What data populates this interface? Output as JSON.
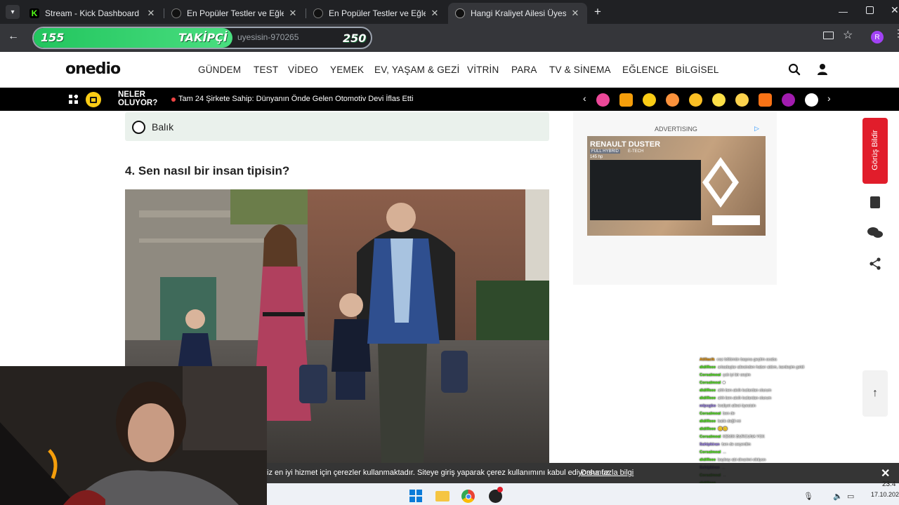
{
  "browser": {
    "tabs": [
      {
        "label": "Stream - Kick Dashboard",
        "icon": "kick-icon",
        "color": "#53fc18"
      },
      {
        "label": "En Popüler Testler ve Eğlenceli",
        "icon": "onedio-icon"
      },
      {
        "label": "En Popüler Testler ve Eğlenceli",
        "icon": "onedio-icon"
      },
      {
        "label": "Hangi Kraliyet Ailesi Üyesisin?",
        "icon": "onedio-icon"
      }
    ],
    "url_fragment": "uyesisin-970265",
    "profile_initial": "R"
  },
  "follow_overlay": {
    "count": "155",
    "label": "TAKİPÇİ",
    "goal": "250",
    "progress": 0.62
  },
  "site": {
    "logo": "onedio",
    "nav": [
      "GÜNDEM",
      "TEST",
      "VİDEO",
      "YEMEK",
      "EV, YAŞAM & GEZİ",
      "VİTRİN",
      "PARA",
      "TV & SİNEMA",
      "EĞLENCE",
      "BİLGİSEL"
    ],
    "ticker_heading": "NELER OLUYOR?",
    "ticker_text": "Tam 24 Şirkete Sahip: Dünyanın Önde Gelen Otomotiv Devi İflas Etti"
  },
  "quiz": {
    "option_label": "Balık",
    "question": "4. Sen nasıl bir insan tipisin?"
  },
  "ad": {
    "label": "ADVERTISING",
    "brand": "RENAULT DUSTER",
    "model": "FULL HYBRID",
    "variant": "E-TECH",
    "power": "145 hp"
  },
  "sidebar": {
    "feedback_label": "Görüş Bildir"
  },
  "cookie": {
    "text": "iz en iyi hizmet için çerezler kullanmaktadır. Siteye giriş yaparak çerez kullanımını kabul ediyorsunuz.",
    "link": "Daha fazla bilgi"
  },
  "chat": [
    {
      "user": "Atillacik",
      "color": "#f59e0b",
      "msg": "ıraz bölümün başına geçtim acaba"
    },
    {
      "user": "didiffeee",
      "color": "#53fc18",
      "msg": "arkadaşlar ailesinden haber aldım, kardeşim geldi"
    },
    {
      "user": "Corsalmeal",
      "color": "#53fc18",
      "msg": "çok iyi bir seçim"
    },
    {
      "user": "Corsalmeal",
      "color": "#53fc18",
      "msg": "■"
    },
    {
      "user": "didiffeee",
      "color": "#53fc18",
      "msg": "ahh ben akıllı kızlardan olurum"
    },
    {
      "user": "didiffeee",
      "color": "#53fc18",
      "msg": "ahh ben akıllı kızlardan olurum"
    },
    {
      "user": "mlpcgbo",
      "color": "#a78bfa",
      "msg": "kraliyet ailesi üyesisin"
    },
    {
      "user": "Corsalmeal",
      "color": "#53fc18",
      "msg": "ben de"
    },
    {
      "user": "didiffeee",
      "color": "#53fc18",
      "msg": "balık değil mi"
    },
    {
      "user": "didiffeee",
      "color": "#53fc18",
      "msg": "🙂🙂"
    },
    {
      "user": "Corsalmeal",
      "color": "#53fc18",
      "msg": "KEMIK BURCUNA YOK"
    },
    {
      "user": "Sahipkiran",
      "color": "#a78bfa",
      "msg": "ben de seçerdim"
    },
    {
      "user": "Corsalmeal",
      "color": "#53fc18",
      "msg": "..."
    },
    {
      "user": "didiffeee",
      "color": "#53fc18",
      "msg": "baybay abi dinarimi ciktiyon"
    },
    {
      "user": "Sahipkiran",
      "color": "#a78bfa",
      "msg": "..."
    },
    {
      "user": "Corsalmeal",
      "color": "#53fc18",
      "msg": "..."
    },
    {
      "user": "didiffeee",
      "color": "#53fc18",
      "msg": "..."
    },
    {
      "user": "Sahipkiran",
      "color": "#a78bfa",
      "msg": "..."
    }
  ],
  "taskbar": {
    "time": "23:4",
    "date": "17.10.202"
  }
}
